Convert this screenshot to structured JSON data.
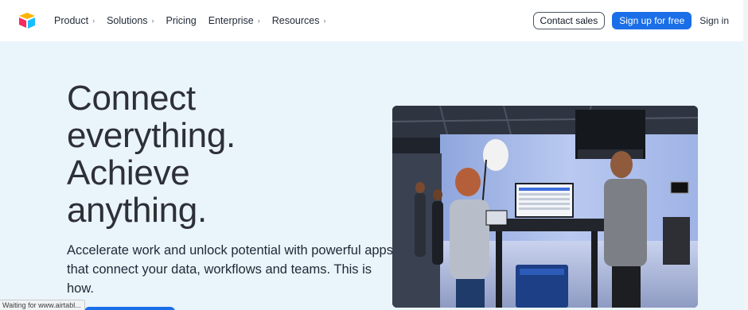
{
  "nav": {
    "logo_icon": "airtable-logo-icon",
    "items": [
      {
        "label": "Product",
        "has_chevron": true
      },
      {
        "label": "Solutions",
        "has_chevron": true
      },
      {
        "label": "Pricing",
        "has_chevron": false
      },
      {
        "label": "Enterprise",
        "has_chevron": true
      },
      {
        "label": "Resources",
        "has_chevron": true
      }
    ],
    "chevron_glyph": "›",
    "contact_sales": "Contact sales",
    "signup": "Sign up for free",
    "signin": "Sign in"
  },
  "hero": {
    "title_lines": [
      "Connect",
      "everything.",
      "Achieve",
      "anything."
    ],
    "subtitle": "Accelerate work and unlock potential with powerful apps that connect your data, workflows and teams. This is how.",
    "image_icon": "studio-presentation-photo"
  },
  "status_bar": {
    "text": "Waiting for www.airtabl..."
  },
  "colors": {
    "background": "#eaf4fb",
    "primary": "#1a6fe8",
    "text": "#2d3036"
  }
}
